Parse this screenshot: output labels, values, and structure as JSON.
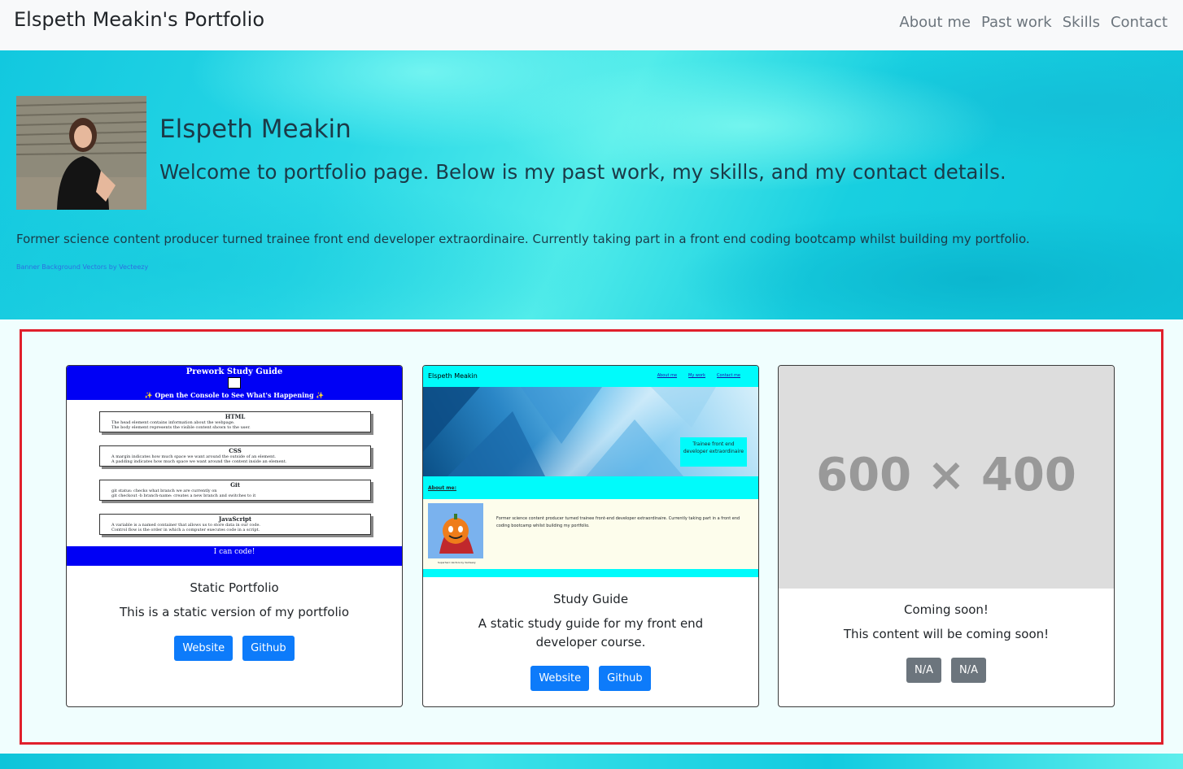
{
  "navbar": {
    "brand": "Elspeth Meakin's Portfolio",
    "links": [
      "About me",
      "Past work",
      "Skills",
      "Contact"
    ]
  },
  "hero": {
    "name": "Elspeth Meakin",
    "lead": "Welcome to portfolio page. Below is my past work, my skills, and my contact details.",
    "description": "Former science content producer turned trainee front end developer extraordinaire. Currently taking part in a front end coding bootcamp whilst building my portfolio.",
    "credit": "Banner Background Vectors by Vecteezy"
  },
  "cards": [
    {
      "title": "Static Portfolio",
      "text": "This is a static version of my portfolio",
      "buttons": [
        "Website",
        "Github"
      ],
      "preview": {
        "heading": "Prework Study Guide",
        "subheading": "✨ Open the Console to See What's Happening ✨",
        "boxes": [
          {
            "title": "HTML",
            "lines": [
              "The head element contains information about the webpage.",
              "The body element represents the visible content shown to the user."
            ]
          },
          {
            "title": "CSS",
            "lines": [
              "A margin indicates how much space we want around the outside of an element.",
              "A padding indicates how much space we want around the content inside an element."
            ]
          },
          {
            "title": "Git",
            "lines": [
              "git status: checks what branch we are currently on",
              "git checkout -b branch-name: creates a new branch and switches to it"
            ]
          },
          {
            "title": "JavaScript",
            "lines": [
              "A variable is a named container that allows us to store data in our code.",
              "Control flow is the order in which a computer executes code in a script."
            ]
          }
        ],
        "footer": "I can code!"
      }
    },
    {
      "title": "Study Guide",
      "text": "A static study guide for my front end developer course.",
      "buttons": [
        "Website",
        "Github"
      ],
      "preview": {
        "name": "Elspeth Meakin",
        "nav": [
          "About me",
          "My work",
          "Contact me"
        ],
        "tag": "Trainee front end developer extraordinaire",
        "about": "About me:",
        "para": "Former science content producer turned trainee front-end developer extraordinaire. Currently taking part in a front end coding bootcamp whilst building my portfolio.",
        "credit": "Superhero Vectors by Vecteezy"
      }
    },
    {
      "title": "Coming soon!",
      "text": "This content will be coming soon!",
      "buttons": [
        "N/A",
        "N/A"
      ],
      "preview": {
        "placeholder": "600 × 400"
      }
    }
  ],
  "colors": {
    "primary_button": "#0d7bfa",
    "secondary_button": "#6c757d",
    "highlight_frame": "#e0202c"
  }
}
